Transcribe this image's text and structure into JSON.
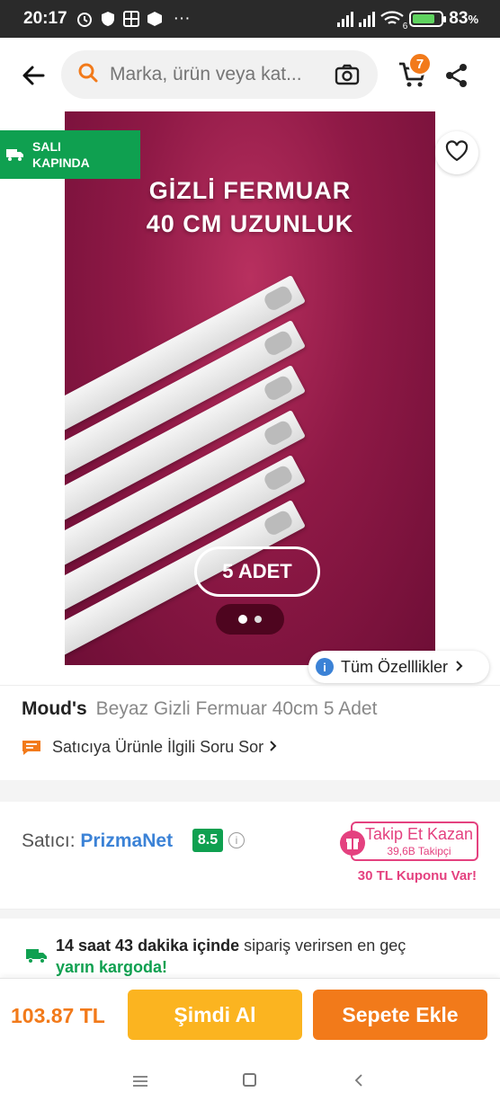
{
  "status_bar": {
    "time": "20:17",
    "dots": "···",
    "battery_pct": "83",
    "battery_unit": "%",
    "wifi_sub": "6"
  },
  "header": {
    "search_placeholder": "Marka, ürün veya kat...",
    "cart_count": "7"
  },
  "product_image": {
    "title_line1": "GİZLİ FERMUAR",
    "title_line2": "40 CM UZUNLUK",
    "count_label": "5 ADET",
    "pages_total": 2,
    "current_page": 1
  },
  "delivery_tag": {
    "line1": "SALI",
    "line2": "KAPINDA"
  },
  "features_chip": {
    "icon_text": "i",
    "label": "Tüm Özelllikler"
  },
  "product": {
    "brand": "Moud's",
    "name": "Beyaz Gizli Fermuar 40cm 5 Adet",
    "ask_seller": "Satıcıya Ürünle İlgili Soru Sor"
  },
  "seller": {
    "label": "Satıcı:",
    "name": "PrizmaNet",
    "rating": "8.5",
    "info_icon": "i",
    "follow_title": "Takip Et Kazan",
    "follow_sub": "39,6B Takipçi",
    "coupon": "30 TL Kuponu Var!"
  },
  "shipping": {
    "bold_part": "14 saat 43 dakika içinde",
    "rest": "sipariş verirsen en geç",
    "line2": "yarın kargoda!"
  },
  "bottom_bar": {
    "price": "103.87 TL",
    "buy_now": "Şimdi Al",
    "add_to_cart": "Sepete Ekle"
  },
  "colors": {
    "brand_orange": "#f27a1a",
    "buy_yellow": "#fbb420",
    "green": "#0fa050",
    "pink": "#e4417f",
    "blue": "#3b82d6"
  },
  "icons": [
    "alarm-icon",
    "shield-icon",
    "grid-icon",
    "box-icon",
    "signal-icon",
    "wifi-icon",
    "battery-icon",
    "back-arrow-icon",
    "search-icon",
    "camera-icon",
    "cart-icon",
    "share-icon",
    "truck-icon",
    "heart-icon",
    "info-icon",
    "chat-icon",
    "chevron-right-icon",
    "gift-icon",
    "menu-icon",
    "home-icon",
    "nav-back-icon"
  ]
}
